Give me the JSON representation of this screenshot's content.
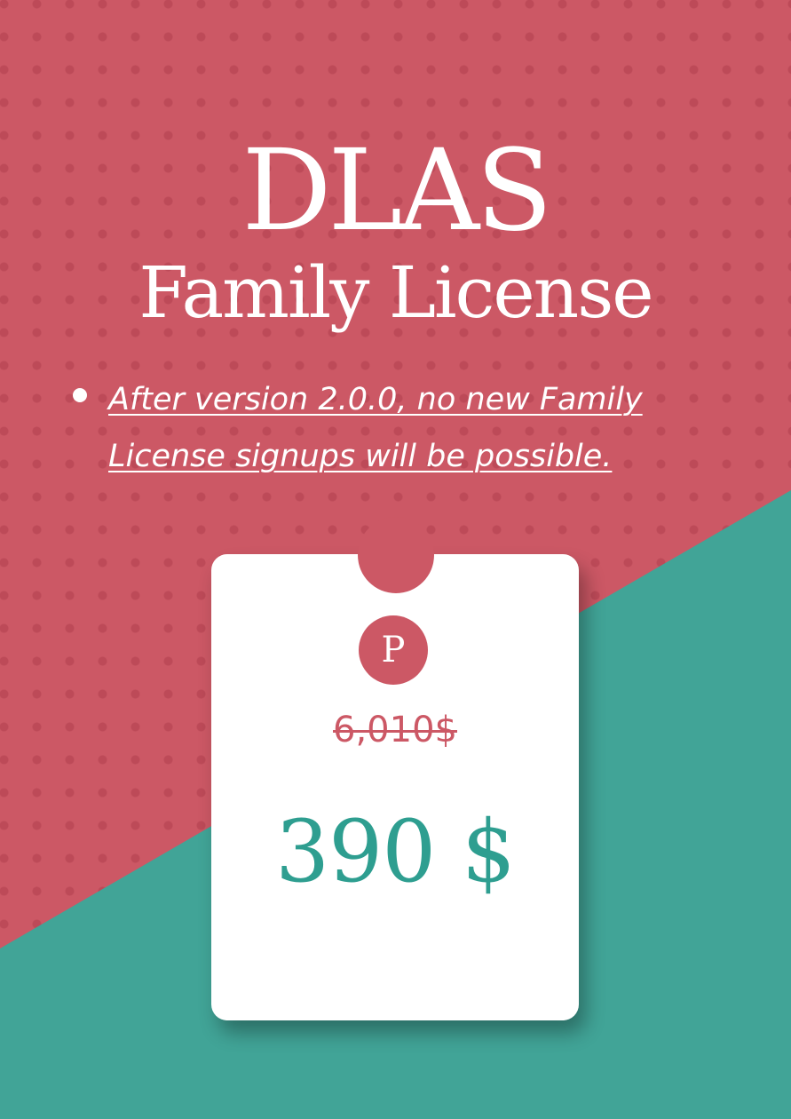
{
  "header": {
    "title": "DLAS",
    "subtitle": "Family License"
  },
  "notice": {
    "items": [
      "After version 2.0.0, no new Family License signups will be possible."
    ]
  },
  "pricing_card": {
    "badge_letter": "P",
    "original_price": "6,010$",
    "price": "390 $"
  },
  "colors": {
    "primary_red": "#cc5865",
    "accent_teal": "#41a497",
    "price_teal": "#2e9e90",
    "card_background": "#ffffff"
  },
  "icons": {
    "bullet": "bullet-dot-icon",
    "badge": "p-badge-icon"
  }
}
